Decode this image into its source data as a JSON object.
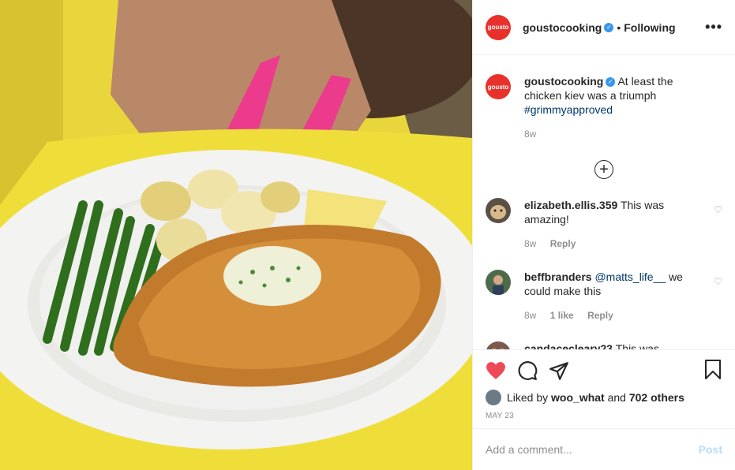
{
  "brand_colors": {
    "gousto_red": "#e8312b",
    "like_red": "#ed4956",
    "link": "#00376b",
    "verified_blue": "#3897f0"
  },
  "photo": {
    "description_icon": "food-photo"
  },
  "header": {
    "avatar_text": "gousto",
    "username": "goustocooking",
    "verified_icon": "verified-badge-icon",
    "separator": "•",
    "follow_state": "Following",
    "more_label": "•••"
  },
  "caption": {
    "avatar_text": "gousto",
    "username": "goustocooking",
    "text": "At least the chicken kiev was a triumph",
    "hashtag": "#grimmyapproved",
    "time": "8w"
  },
  "comments": [
    {
      "username": "elizabeth.ellis.359",
      "text": "This was amazing!",
      "time": "8w",
      "likes": "",
      "reply": "Reply"
    },
    {
      "username": "beffbranders",
      "mention": "@matts_life__",
      "text": "we could make this",
      "time": "8w",
      "likes": "1 like",
      "reply": "Reply"
    },
    {
      "username": "candacecleary23",
      "text": "This was delicious! 💗thanks Gousto",
      "time": "",
      "likes": "",
      "reply": ""
    }
  ],
  "actions": {
    "like_icon": "heart-filled-icon",
    "comment_icon": "comment-icon",
    "share_icon": "send-icon",
    "save_icon": "bookmark-icon"
  },
  "likes": {
    "prefix": "Liked by",
    "user": "woo_what",
    "middle": "and",
    "others": "702 others"
  },
  "date": "MAY 23",
  "add_comment": {
    "placeholder": "Add a comment...",
    "post_label": "Post"
  }
}
